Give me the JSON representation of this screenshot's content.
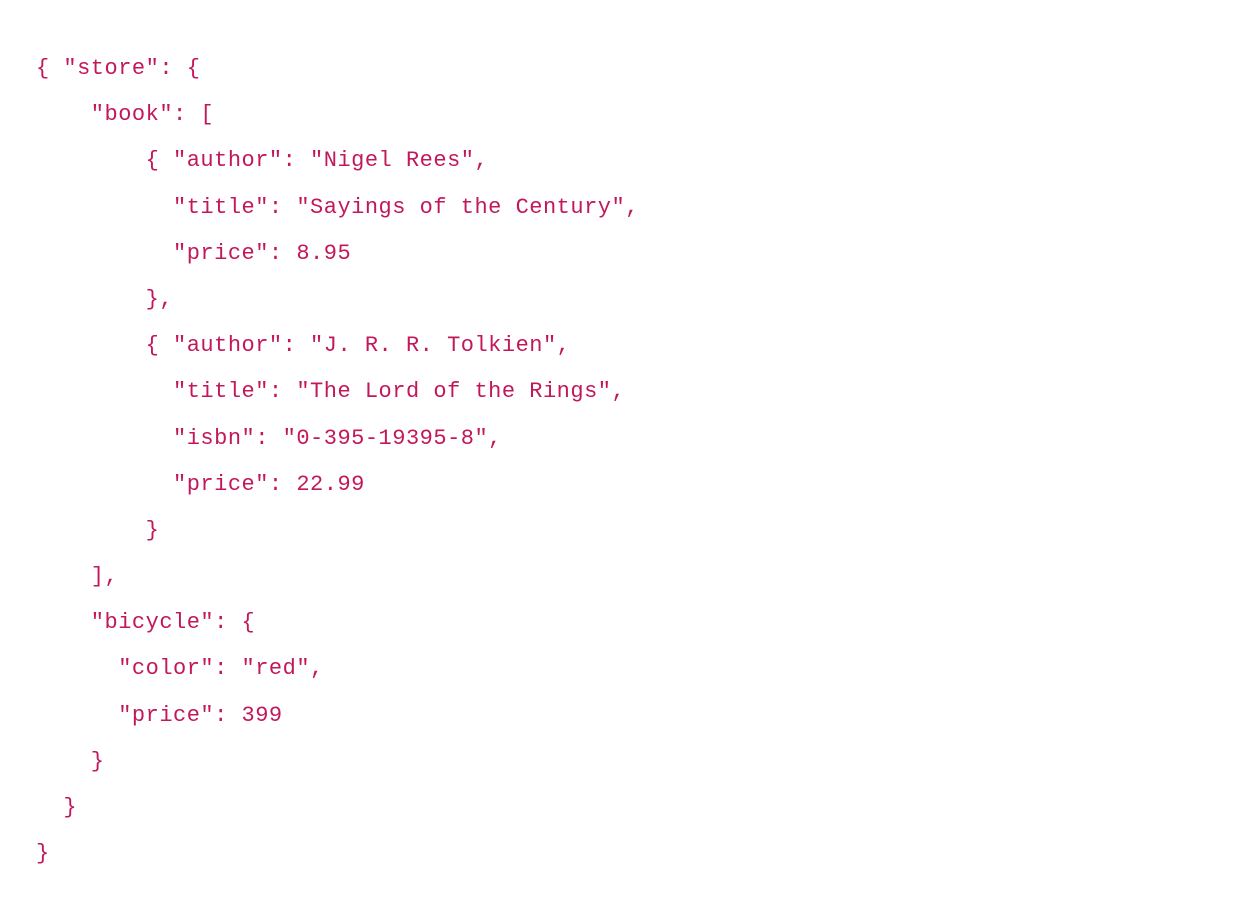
{
  "code": {
    "lines": [
      "{ \"store\": {",
      "    \"book\": [",
      "        { \"author\": \"Nigel Rees\",",
      "          \"title\": \"Sayings of the Century\",",
      "          \"price\": 8.95",
      "        },",
      "        { \"author\": \"J. R. R. Tolkien\",",
      "          \"title\": \"The Lord of the Rings\",",
      "          \"isbn\": \"0-395-19395-8\",",
      "          \"price\": 22.99",
      "        }",
      "    ],",
      "    \"bicycle\": {",
      "      \"color\": \"red\",",
      "      \"price\": 399",
      "    }",
      "  }",
      "}"
    ]
  },
  "json_value": {
    "store": {
      "book": [
        {
          "author": "Nigel Rees",
          "title": "Sayings of the Century",
          "price": 8.95
        },
        {
          "author": "J. R. R. Tolkien",
          "title": "The Lord of the Rings",
          "isbn": "0-395-19395-8",
          "price": 22.99
        }
      ],
      "bicycle": {
        "color": "red",
        "price": 399
      }
    }
  }
}
